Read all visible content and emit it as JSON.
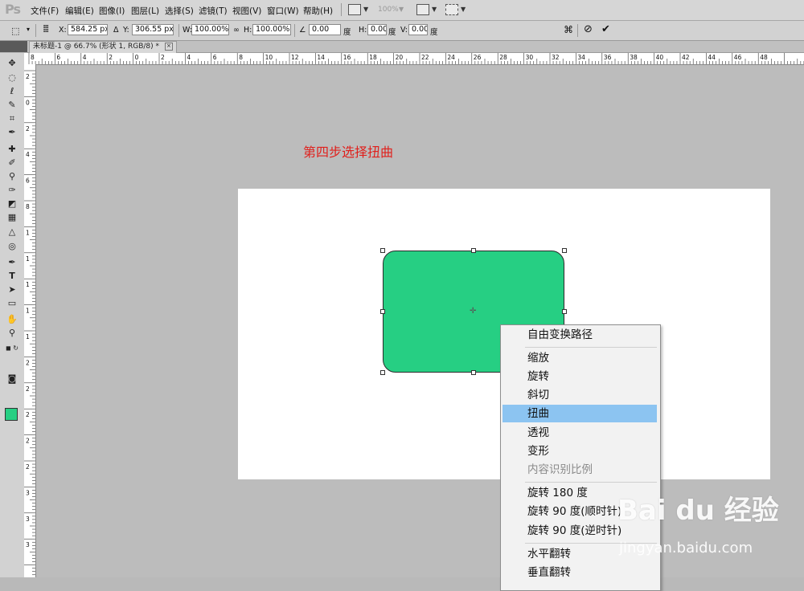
{
  "app": {
    "logo": "Ps"
  },
  "menubar": {
    "items": [
      "文件(F)",
      "编辑(E)",
      "图像(I)",
      "图层(L)",
      "选择(S)",
      "滤镜(T)",
      "视图(V)",
      "窗口(W)",
      "帮助(H)"
    ],
    "zoom": "100%"
  },
  "options": {
    "x_label": "X:",
    "x_value": "584.25 px",
    "y_label": "Y:",
    "y_value": "306.55 px",
    "w_label": "W:",
    "w_value": "100.00%",
    "h_label": "H:",
    "h_value": "100.00%",
    "angle_value": "0.00",
    "angle_unit": "度",
    "hskew_label": "H:",
    "hskew_value": "0.00",
    "hskew_unit": "度",
    "vskew_label": "V:",
    "vskew_value": "0.00",
    "vskew_unit": "度",
    "cancel_icon": "cancel-transform-icon",
    "commit_icon": "commit-transform-icon"
  },
  "document": {
    "tab_title": "未标题-1 @ 66.7% (形状 1, RGB/8) *",
    "tab_close": "×"
  },
  "ruler": {
    "top_labels": [
      "8",
      "6",
      "4",
      "2",
      "0",
      "2",
      "4",
      "6",
      "8",
      "10",
      "12",
      "14",
      "16",
      "18",
      "20",
      "22",
      "24",
      "26",
      "28",
      "30",
      "32",
      "34",
      "36",
      "38",
      "40",
      "42",
      "44",
      "46",
      "48"
    ],
    "left_labels": [
      "2",
      "0",
      "2",
      "4",
      "6",
      "8",
      "1",
      "1",
      "1",
      "1",
      "1",
      "2",
      "2",
      "2",
      "2",
      "2",
      "3",
      "3",
      "3"
    ]
  },
  "canvas": {
    "annotation": "第四步选择扭曲",
    "shape_color": "#26cf83"
  },
  "tools": {
    "foreground_color": "#26cf83"
  },
  "context_menu": {
    "groups": [
      [
        {
          "label": "自由变换路径",
          "state": "normal"
        }
      ],
      [
        {
          "label": "缩放",
          "state": "normal"
        },
        {
          "label": "旋转",
          "state": "normal"
        },
        {
          "label": "斜切",
          "state": "normal"
        },
        {
          "label": "扭曲",
          "state": "hover"
        },
        {
          "label": "透视",
          "state": "normal"
        },
        {
          "label": "变形",
          "state": "normal"
        },
        {
          "label": "内容识别比例",
          "state": "disabled"
        }
      ],
      [
        {
          "label": "旋转 180 度",
          "state": "normal"
        },
        {
          "label": "旋转 90 度(顺时针)",
          "state": "normal"
        },
        {
          "label": "旋转 90 度(逆时针)",
          "state": "normal"
        }
      ],
      [
        {
          "label": "水平翻转",
          "state": "normal"
        },
        {
          "label": "垂直翻转",
          "state": "normal"
        }
      ]
    ],
    "accent": "#8cc4f1"
  },
  "watermark": {
    "brand": "Bai du 经验",
    "url": "jingyan.baidu.com"
  }
}
